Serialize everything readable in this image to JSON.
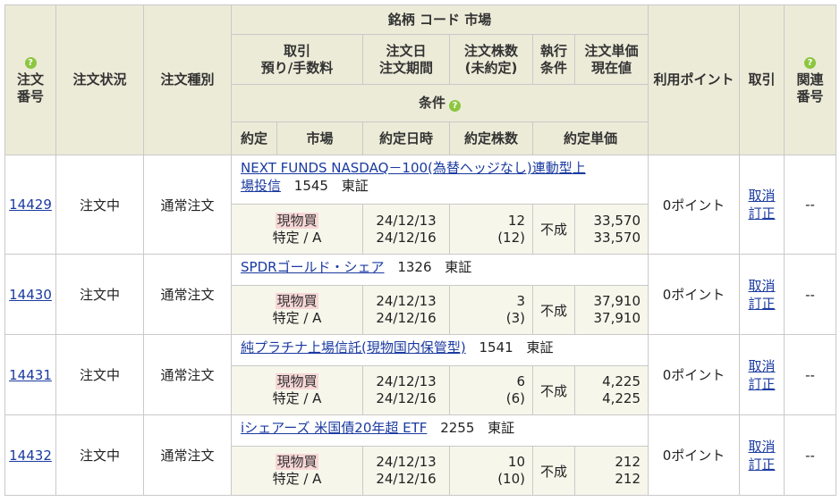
{
  "header": {
    "order_no": [
      "注文",
      "番号"
    ],
    "status": "注文状況",
    "type": "注文種別",
    "stock": "銘柄 コード 市場",
    "trade": [
      "取引",
      "預り/手数料"
    ],
    "order_date": [
      "注文日",
      "注文期間"
    ],
    "order_qty": [
      "注文株数",
      "(未約定)"
    ],
    "exec": [
      "執行",
      "条件"
    ],
    "price": [
      "注文単価",
      "現在値"
    ],
    "points": "利用ポイント",
    "action": "取引",
    "related": [
      "関連",
      "番号"
    ],
    "condition": "条件",
    "exec_row": [
      "約定",
      "市場",
      "約定日時",
      "約定株数",
      "約定単価"
    ]
  },
  "orders": [
    {
      "no": "14429",
      "status": "注文中",
      "type": "通常注文",
      "name_line1": "NEXT FUNDS NASDAQ－100(為替ヘッジなし)連動型上",
      "name_line2": "場投信",
      "code": "1545",
      "market": "東証",
      "trade": "現物買",
      "account": "特定 / A",
      "date": "24/12/13",
      "period": "24/12/16",
      "qty": "12",
      "unfilled": "(12)",
      "cond": "不成",
      "price": "33,570",
      "current": "33,570",
      "points": "0ポイント",
      "cancel": "取消",
      "modify": "訂正",
      "related": "--"
    },
    {
      "no": "14430",
      "status": "注文中",
      "type": "通常注文",
      "name_line1": "SPDRゴールド・シェア",
      "name_line2": "",
      "code": "1326",
      "market": "東証",
      "trade": "現物買",
      "account": "特定 / A",
      "date": "24/12/13",
      "period": "24/12/16",
      "qty": "3",
      "unfilled": "(3)",
      "cond": "不成",
      "price": "37,910",
      "current": "37,910",
      "points": "0ポイント",
      "cancel": "取消",
      "modify": "訂正",
      "related": "--"
    },
    {
      "no": "14431",
      "status": "注文中",
      "type": "通常注文",
      "name_line1": "純プラチナ上場信託(現物国内保管型)",
      "name_line2": "",
      "code": "1541",
      "market": "東証",
      "trade": "現物買",
      "account": "特定 / A",
      "date": "24/12/13",
      "period": "24/12/16",
      "qty": "6",
      "unfilled": "(6)",
      "cond": "不成",
      "price": "4,225",
      "current": "4,225",
      "points": "0ポイント",
      "cancel": "取消",
      "modify": "訂正",
      "related": "--"
    },
    {
      "no": "14432",
      "status": "注文中",
      "type": "通常注文",
      "name_line1": "iシェアーズ 米国債20年超 ETF",
      "name_line2": "",
      "code": "2255",
      "market": "東証",
      "trade": "現物買",
      "account": "特定 / A",
      "date": "24/12/13",
      "period": "24/12/16",
      "qty": "10",
      "unfilled": "(10)",
      "cond": "不成",
      "price": "212",
      "current": "212",
      "points": "0ポイント",
      "cancel": "取消",
      "modify": "訂正",
      "related": "--"
    }
  ],
  "colors": {
    "header_bg": "#ecebd8",
    "link": "#1a3aa0",
    "badge_bg": "#f7d6d6",
    "help_icon": "#8cc63f"
  },
  "icons": {
    "help": "question-circle-icon"
  }
}
